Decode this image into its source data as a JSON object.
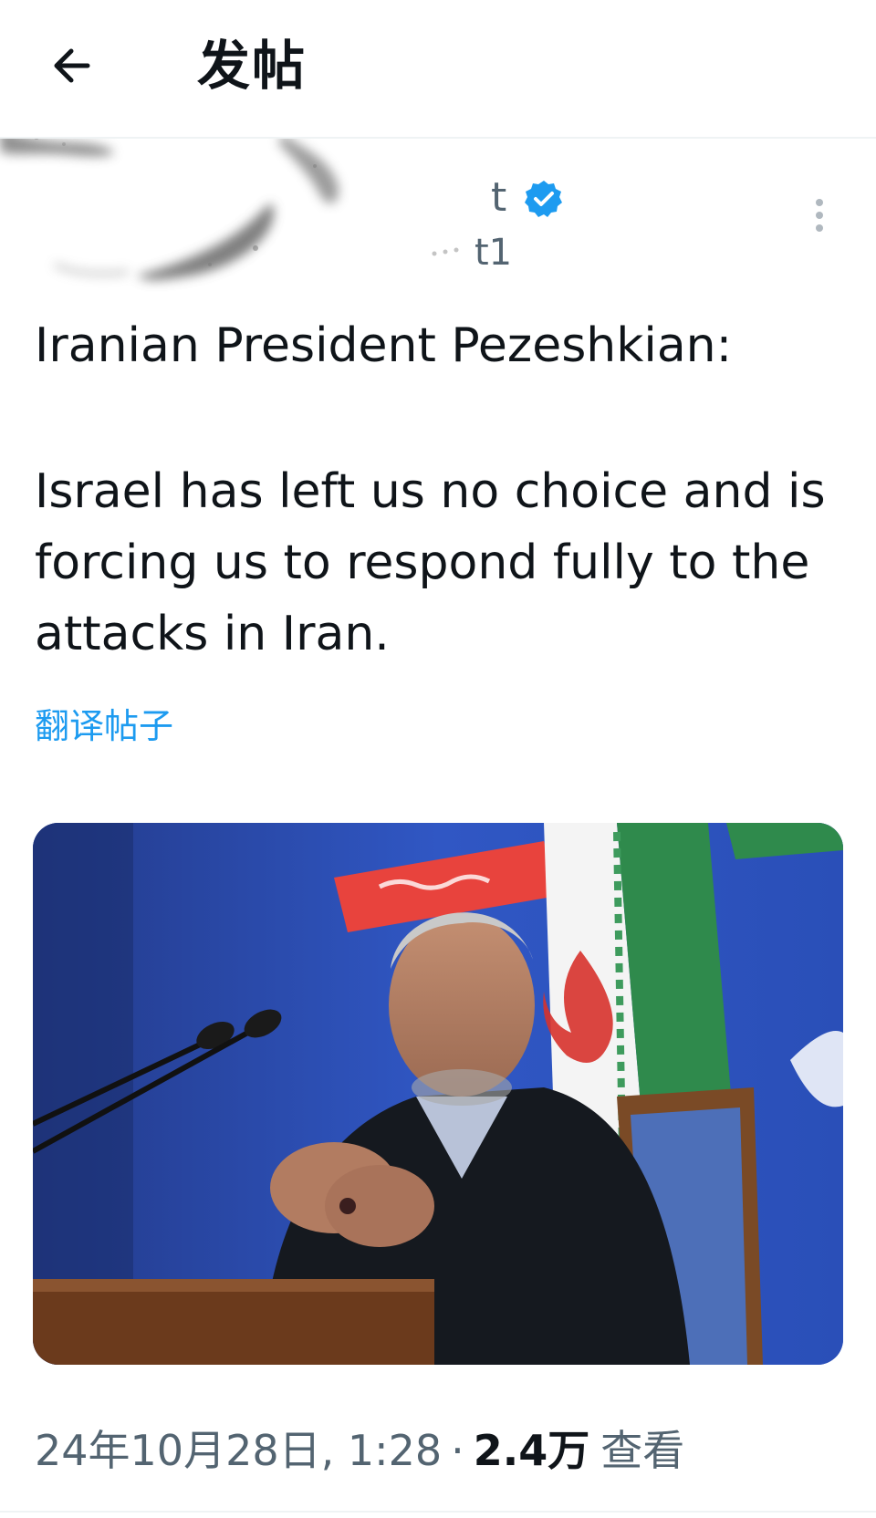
{
  "header": {
    "title": "发帖",
    "back_icon": "arrow-left-icon"
  },
  "author": {
    "name_fragment": "t",
    "handle_fragment": "t1",
    "verified_icon": "verified-badge-icon",
    "verified_color": "#1d9bf0",
    "more_icon": "more-vertical-icon"
  },
  "post": {
    "line1": "Iranian President Pezeshkian:",
    "line2": "Israel has left us no choice and is forcing us to respond fully to the attacks in Iran.",
    "translate_label": "翻译帖子"
  },
  "meta": {
    "date": "24年10月28日, 1:28",
    "separator": "·",
    "views_count": "2.4万",
    "views_label": "查看"
  },
  "colors": {
    "text_primary": "#0f1419",
    "text_secondary": "#536471",
    "link": "#1d9bf0",
    "divider": "#eff3f4"
  }
}
